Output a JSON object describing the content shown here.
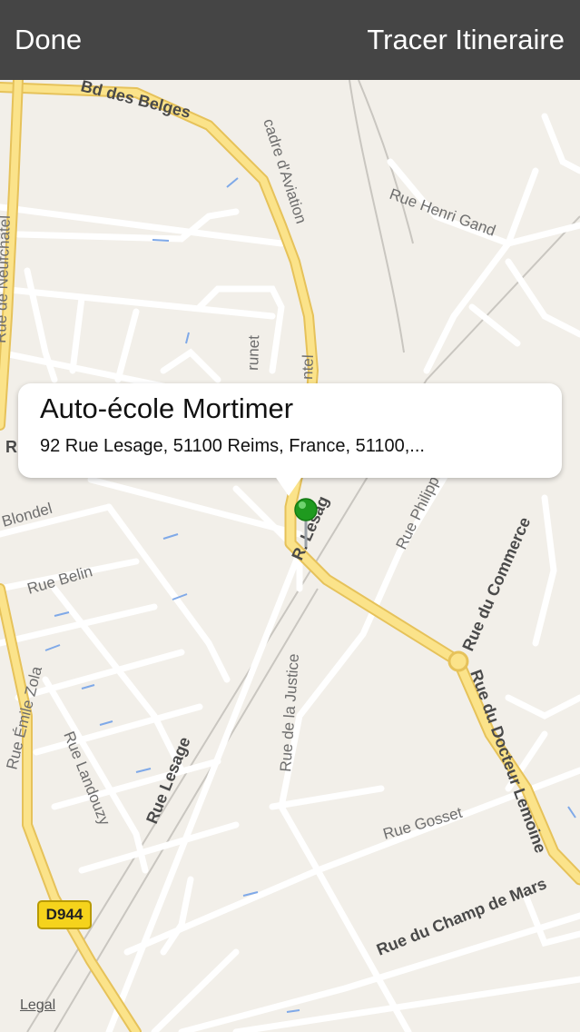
{
  "navbar": {
    "done_label": "Done",
    "route_label": "Tracer Itineraire"
  },
  "callout": {
    "title": "Auto-école Mortimer",
    "subtitle": "92 Rue Lesage, 51100 Reims, France, 51100,..."
  },
  "map": {
    "streets": {
      "bd_des_belges": "Bd des Belges",
      "esc_aviation": "cadre d'Aviation",
      "henri_gand": "Rue Henri Gand",
      "neufchatel": "Rue de Neufchâtel",
      "blondel": "Blondel",
      "belin": "Rue Belin",
      "emile_zola": "Rue Émile Zola",
      "landouzy": "Rue Landouzy",
      "lesage": "Rue Lesage",
      "lesage_top": "R. Lesag",
      "justice": "Rue de la Justice",
      "philippe": "Rue Philipp",
      "commerce": "Rue du Commerce",
      "docteur_lemoine": "Rue du Docteur Lemoine",
      "gosset": "Rue Gosset",
      "champ_de_mars": "Rue du Champ de Mars",
      "brunet": "runet",
      "ntel": "ntel",
      "r_fragment": "R"
    },
    "road_shield": "D944",
    "legal_label": "Legal",
    "pin_color": "#1f9a1f"
  }
}
